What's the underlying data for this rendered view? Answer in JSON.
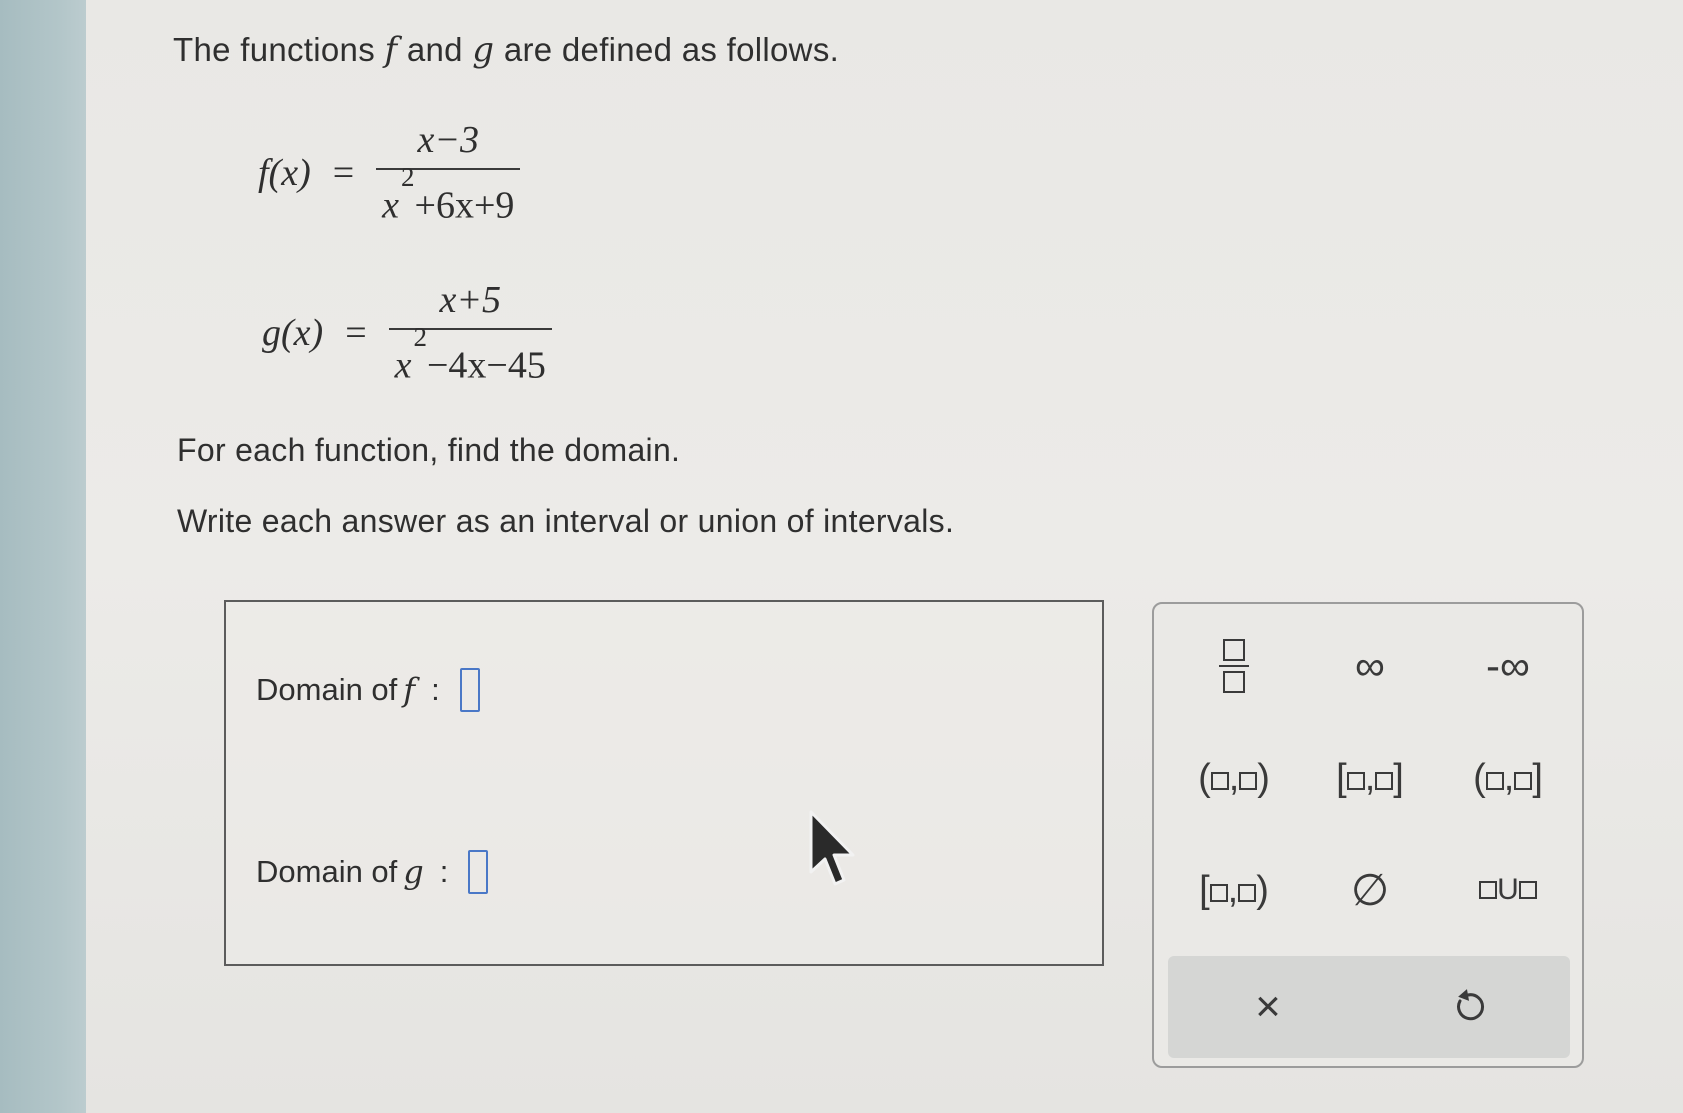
{
  "problem": {
    "intro_before": "The functions ",
    "intro_f": "f",
    "intro_mid": " and ",
    "intro_g": "g",
    "intro_after": " are defined as follows.",
    "f_lhs": "f(x)",
    "f_numerator": "x−3",
    "f_denominator_base": "x",
    "f_denominator_exp": "2",
    "f_denominator_rest": "+6x+9",
    "g_lhs": "g(x)",
    "g_numerator": "x+5",
    "g_denominator_base": "x",
    "g_denominator_exp": "2",
    "g_denominator_rest": "−4x−45",
    "equals": "=",
    "instruction_1": "For each function, find the domain.",
    "instruction_2": "Write each answer as an interval or union of intervals."
  },
  "answers": {
    "domain_f_label": "Domain of ",
    "domain_f_var": "f",
    "domain_g_label": "Domain of ",
    "domain_g_var": "g",
    "colon": ":",
    "domain_f_value": "",
    "domain_g_value": ""
  },
  "keypad": {
    "infinity": "∞",
    "neg_infinity": "-∞",
    "empty_set": "∅",
    "union_symbol": "U",
    "clear_symbol": "×",
    "undo_icon": "undo-icon"
  },
  "colors": {
    "input_border": "#4a78c7",
    "sidebar": "#a6bcc0",
    "text": "#2f2f2f"
  }
}
